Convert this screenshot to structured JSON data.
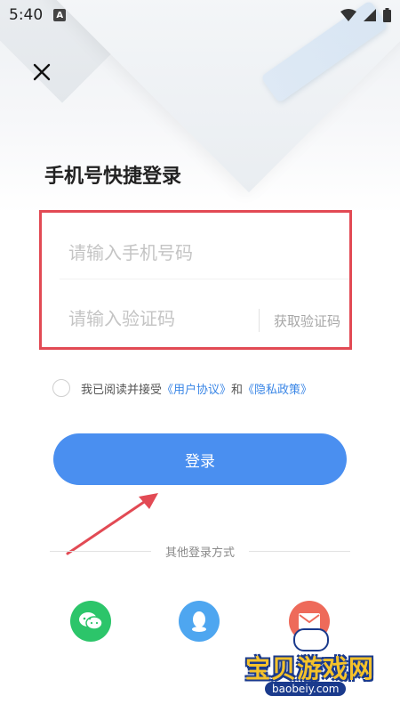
{
  "status_bar": {
    "time": "5:40",
    "notification_letter": "A"
  },
  "header": {
    "title": "手机号快捷登录"
  },
  "form": {
    "phone_placeholder": "请输入手机号码",
    "code_placeholder": "请输入验证码",
    "get_code_label": "获取验证码"
  },
  "agreement": {
    "prefix": "我已阅读并接受",
    "user_agreement": "《用户协议》",
    "and": "和",
    "privacy_policy": "《隐私政策》"
  },
  "login_button": {
    "label": "登录"
  },
  "other_login": {
    "label": "其他登录方式",
    "methods": [
      "wechat-icon",
      "qq-icon",
      "mail-icon"
    ]
  },
  "watermark": {
    "title": "宝贝游戏网",
    "url": "baobeiy.com"
  },
  "colors": {
    "primary": "#4a8ff0",
    "highlight_box": "#e24a54",
    "link": "#3a86e6",
    "wechat": "#2cc56a",
    "qq": "#4ea6f0",
    "mail": "#ee6a5a"
  }
}
